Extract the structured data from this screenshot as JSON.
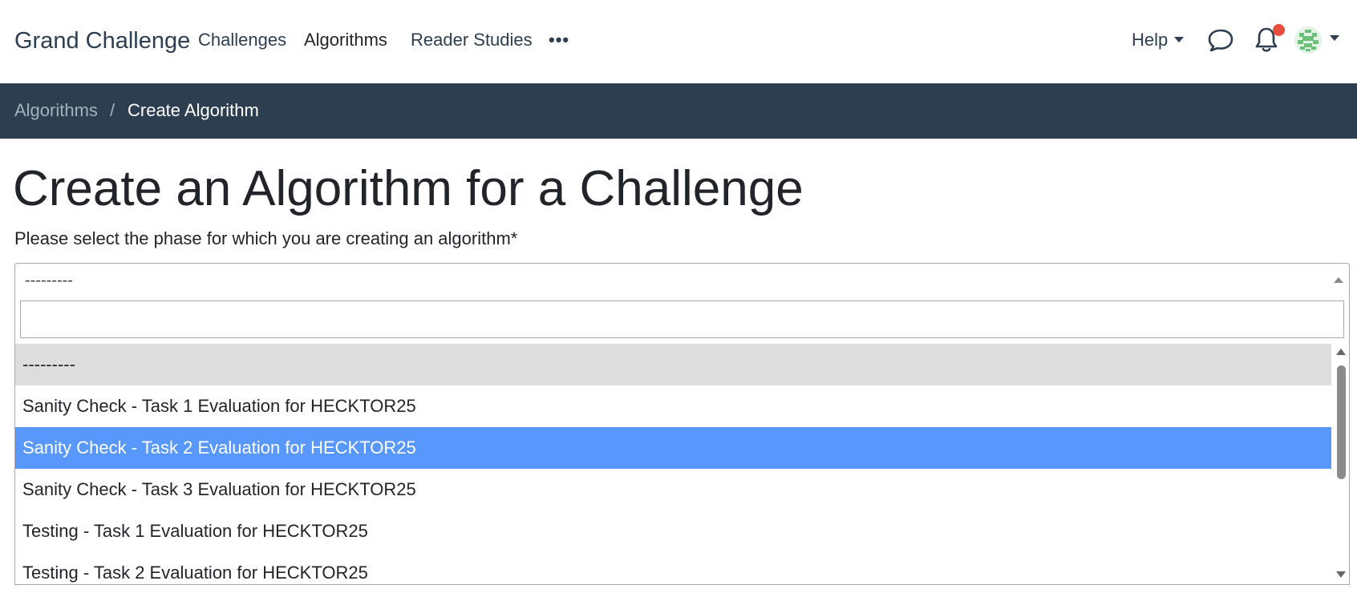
{
  "navbar": {
    "brand": "Grand Challenge",
    "links": [
      {
        "label": "Challenges"
      },
      {
        "label": "Algorithms"
      },
      {
        "label": "Reader Studies"
      }
    ],
    "more": "•••",
    "help": "Help",
    "icons": {
      "messages": "speech-bubble-icon",
      "notifications": "bell-icon",
      "avatar": "user-avatar"
    },
    "notification_color": "#e74c3c"
  },
  "breadcrumb": {
    "items": [
      {
        "label": "Algorithms"
      },
      {
        "label": "Create Algorithm"
      }
    ],
    "separator": "/"
  },
  "page": {
    "title": "Create an Algorithm for a Challenge",
    "field_label": "Please select the phase for which you are creating an algorithm*"
  },
  "select": {
    "value": "---------",
    "search_placeholder": "",
    "options": [
      {
        "label": "---------"
      },
      {
        "label": "Sanity Check - Task 1 Evaluation for HECKTOR25"
      },
      {
        "label": "Sanity Check - Task 2 Evaluation for HECKTOR25"
      },
      {
        "label": "Sanity Check - Task 3 Evaluation for HECKTOR25"
      },
      {
        "label": "Testing - Task 1 Evaluation for HECKTOR25"
      },
      {
        "label": "Testing - Task 2 Evaluation for HECKTOR25"
      }
    ],
    "highlighted_color": "#5897fb"
  },
  "colors": {
    "breadcrumb_bg": "#2c3e50",
    "text": "#212529"
  }
}
